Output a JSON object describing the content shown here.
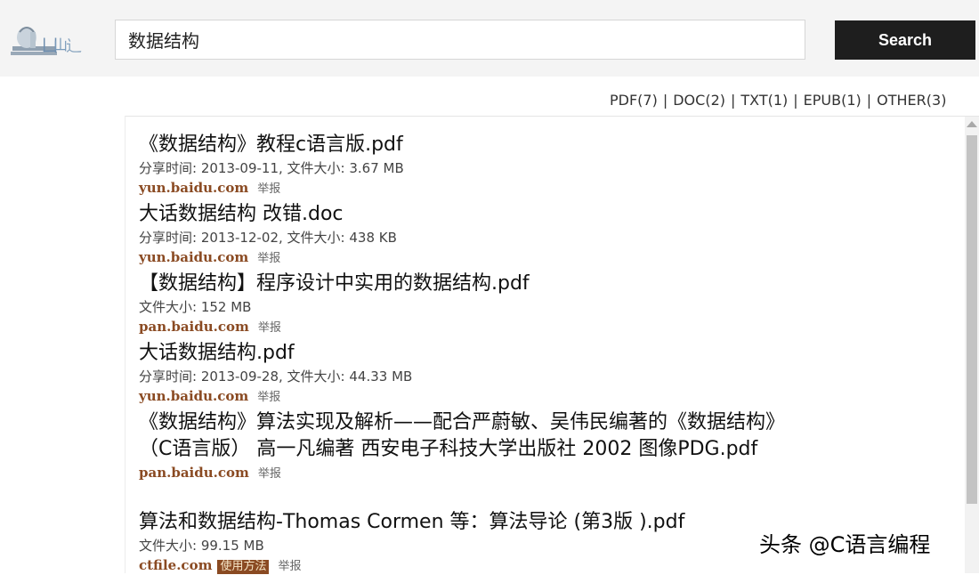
{
  "header": {
    "search_value": "数据结构",
    "search_button": "Search"
  },
  "filters": [
    {
      "label": "PDF(7)"
    },
    {
      "label": "DOC(2)"
    },
    {
      "label": "TXT(1)"
    },
    {
      "label": "EPUB(1)"
    },
    {
      "label": "OTHER(3)"
    }
  ],
  "results": [
    {
      "title": "《数据结构》教程c语言版.pdf",
      "meta": "分享时间: 2013-09-11, 文件大小: 3.67 MB",
      "source": "yun.baidu.com",
      "report": "举报"
    },
    {
      "title": "大话数据结构 改错.doc",
      "meta": "分享时间: 2013-12-02, 文件大小: 438 KB",
      "source": "yun.baidu.com",
      "report": "举报"
    },
    {
      "title": "【数据结构】程序设计中实用的数据结构.pdf",
      "meta": "文件大小: 152 MB",
      "source": "pan.baidu.com",
      "report": "举报"
    },
    {
      "title": "大话数据结构.pdf",
      "meta": "分享时间: 2013-09-28, 文件大小: 44.33 MB",
      "source": "yun.baidu.com",
      "report": "举报"
    },
    {
      "title": "《数据结构》算法实现及解析——配合严蔚敏、吴伟民编著的《数据结构》（C语言版） 高一凡编著 西安电子科技大学出版社 2002 图像PDG.pdf",
      "source": "pan.baidu.com",
      "report": "举报"
    },
    {
      "title": "算法和数据结构-Thomas Cormen 等：算法导论 (第3版 ).pdf",
      "meta": "文件大小: 99.15 MB",
      "source": "ctfile.com",
      "tag": "使用方法",
      "report": "举报"
    }
  ],
  "watermark": "头条 @C语言编程"
}
